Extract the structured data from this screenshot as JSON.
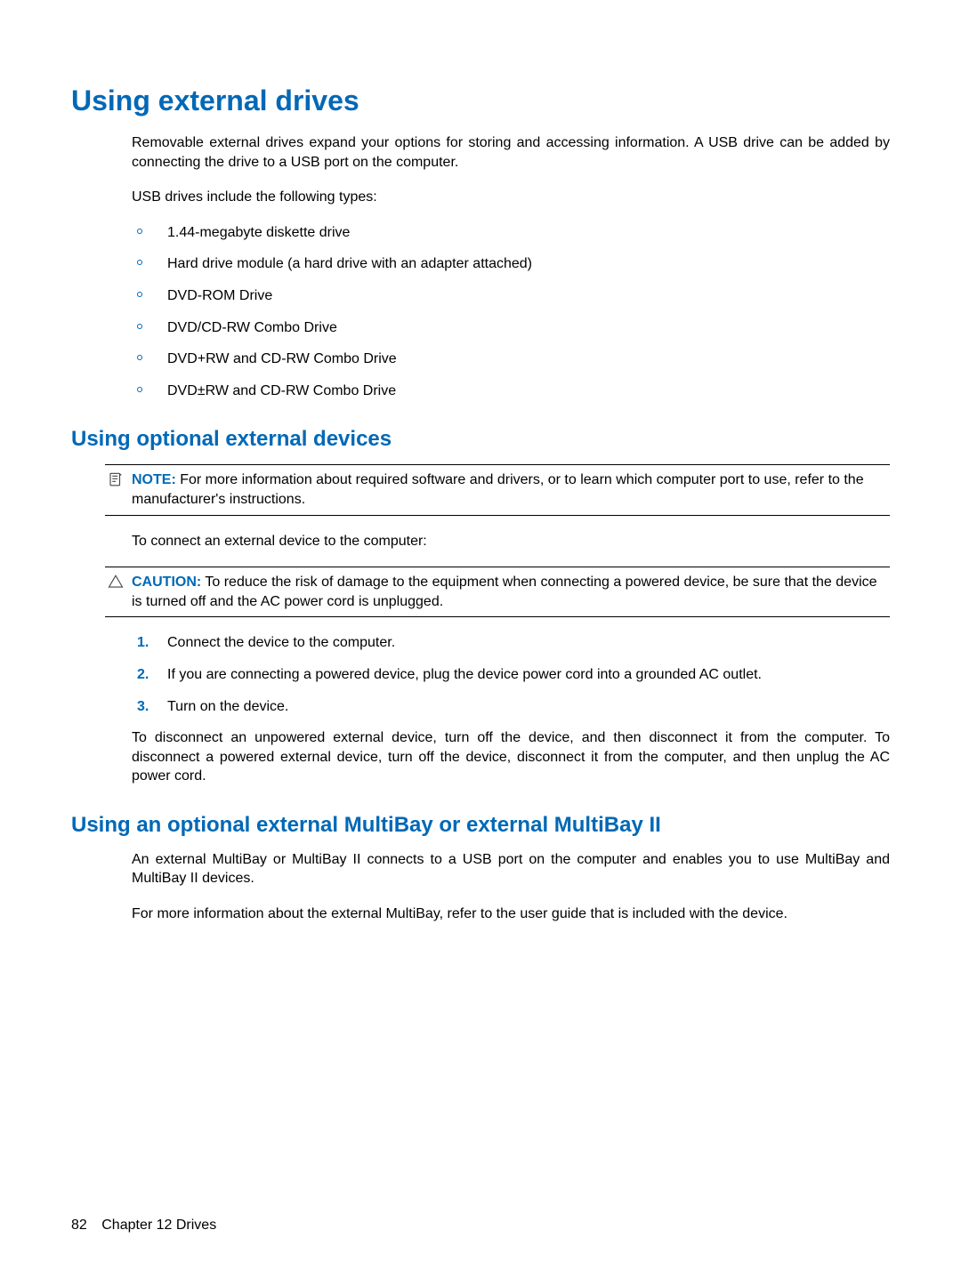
{
  "heading1": "Using external drives",
  "intro_para": "Removable external drives expand your options for storing and accessing information. A USB drive can be added by connecting the drive to a USB port on the computer.",
  "usb_types_intro": "USB drives include the following types:",
  "usb_types": [
    "1.44-megabyte diskette drive",
    "Hard drive module (a hard drive with an adapter attached)",
    "DVD-ROM Drive",
    "DVD/CD-RW Combo Drive",
    "DVD+RW and CD-RW Combo Drive",
    "DVD±RW and CD-RW Combo Drive"
  ],
  "heading2a": "Using optional external devices",
  "note_label": "NOTE:",
  "note_text": "For more information about required software and drivers, or to learn which computer port to use, refer to the manufacturer's instructions.",
  "connect_intro": "To connect an external device to the computer:",
  "caution_label": "CAUTION:",
  "caution_text": "To reduce the risk of damage to the equipment when connecting a powered device, be sure that the device is turned off and the AC power cord is unplugged.",
  "steps": [
    "Connect the device to the computer.",
    "If you are connecting a powered device, plug the device power cord into a grounded AC outlet.",
    "Turn on the device."
  ],
  "disconnect_para": "To disconnect an unpowered external device, turn off the device, and then disconnect it from the computer. To disconnect a powered external device, turn off the device, disconnect it from the computer, and then unplug the AC power cord.",
  "heading2b": "Using an optional external MultiBay or external MultiBay II",
  "multibay_para1": "An external MultiBay or MultiBay II connects to a USB port on the computer and enables you to use MultiBay and MultiBay II devices.",
  "multibay_para2": "For more information about the external MultiBay, refer to the user guide that is included with the device.",
  "footer": {
    "page_number": "82",
    "chapter": "Chapter 12   Drives"
  }
}
